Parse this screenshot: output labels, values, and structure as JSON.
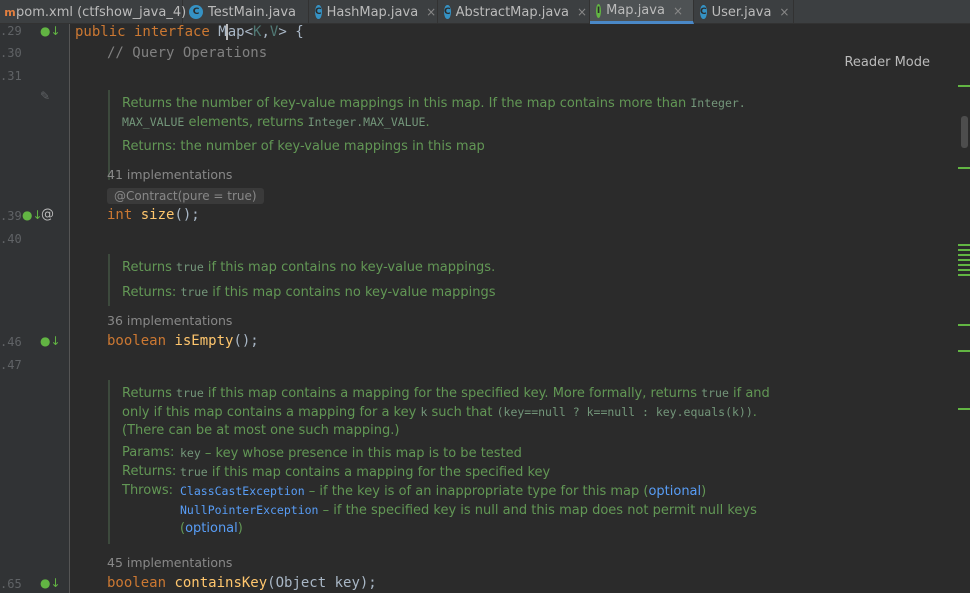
{
  "tabs": [
    {
      "label": "pom.xml (ctfshow_java_4)",
      "icon": "xml-icon"
    },
    {
      "label": "TestMain.java",
      "icon": "class-icon"
    },
    {
      "label": "HashMap.java",
      "icon": "class-icon"
    },
    {
      "label": "AbstractMap.java",
      "icon": "abstract-class-icon"
    },
    {
      "label": "Map.java",
      "icon": "interface-icon",
      "active": true
    },
    {
      "label": "User.java",
      "icon": "class-icon"
    }
  ],
  "gutter": {
    "line_numbers": [
      ".29",
      ".30",
      ".31",
      ".39",
      ".40",
      ".46",
      ".47",
      ".65"
    ]
  },
  "reader_mode": "Reader Mode",
  "code": {
    "line1": {
      "kw": "public interface ",
      "type_before": "",
      "type_name_a": "M",
      "type_name_b": "ap",
      "generic_open": "<",
      "k": "K",
      "comma": ",",
      "v": "V",
      "generic_close": "> {"
    },
    "comment": "// Query Operations",
    "size_line": {
      "kw": "int ",
      "fn": "size",
      "rest": "();"
    },
    "isEmpty_line": {
      "kw": "boolean ",
      "fn": "isEmpty",
      "rest": "();"
    },
    "containsKey_line": {
      "kw": "boolean ",
      "fn": "containsKey",
      "rest": "(Object key);"
    }
  },
  "docs": {
    "size": {
      "line1_a": "Returns the number of key-value mappings in this map. If the map contains more than ",
      "line1_code": "Integer.",
      "line2_code1": "MAX_VALUE",
      "line2_text": " elements, returns ",
      "line2_code2": "Integer.MAX_VALUE",
      "line2_end": ".",
      "returns": "Returns: the number of key-value mappings in this map"
    },
    "isEmpty": {
      "a": "Returns ",
      "code": "true",
      "b": " if this map contains no key-value mappings.",
      "ret_a": "Returns: ",
      "ret_code": "true",
      "ret_b": " if this map contains no key-value mappings"
    },
    "containsKey": {
      "l1_a": "Returns ",
      "l1_code1": "true",
      "l1_b": " if this map contains a mapping for the specified key. More formally, returns ",
      "l1_code2": "true",
      "l1_c": " if and",
      "l2_a": "only if this map contains a mapping for a key ",
      "l2_code1": "k",
      "l2_b": " such that ",
      "l2_code2": "(key==null ? k==null : key.equals(k))",
      "l2_c": ".",
      "l3": "(There can be at most one such mapping.)",
      "params_label": "Params:",
      "params_code": "key",
      "params_text": " – key whose presence in this map is to be tested",
      "returns_label": "Returns:",
      "returns_code": "true",
      "returns_text": " if this map contains a mapping for the specified key",
      "throws_label": "Throws:",
      "throws1_code": "ClassCastException",
      "throws1_text": " – if the key is of an inappropriate type for this map (",
      "throws1_link": "optional",
      "throws1_end": ")",
      "throws2_code": "NullPointerException",
      "throws2_text": " – if the specified key is null and this map does not permit null keys",
      "throws2_open": "(",
      "throws2_link": "optional",
      "throws2_end": ")"
    }
  },
  "implementations": {
    "size": "41 implementations",
    "isEmpty": "36 implementations",
    "containsKey": "45 implementations"
  },
  "annotation": "@Contract(pure = true)",
  "colors": {
    "keyword": "#cc7832",
    "function": "#ffc66d",
    "doc": "#629755",
    "link": "#589df6"
  }
}
